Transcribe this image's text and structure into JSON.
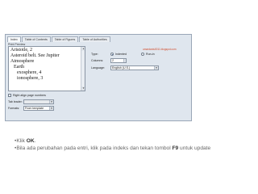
{
  "dialog": {
    "tabs": [
      {
        "label": "Index",
        "active": true
      },
      {
        "label": "Table of Contents",
        "active": false
      },
      {
        "label": "Table of Figures",
        "active": false
      },
      {
        "label": "Table of Authorities",
        "active": false
      }
    ],
    "print_preview_label": "Print Preview",
    "preview_lines": [
      "Aristotle, 2",
      "Asteroid belt. See Jupiter",
      "Atmosphere",
      "Earth",
      "exosphere, 4",
      "ionosphere, 3"
    ],
    "watermark": "umardanis0011.blogspot.com",
    "type_label": "Type:",
    "type_options": [
      {
        "label": "Indented",
        "selected": true
      },
      {
        "label": "Run-in",
        "selected": false
      }
    ],
    "columns_label": "Columns:",
    "columns_value": "2",
    "language_label": "Language:",
    "language_value": "English (U.S.)",
    "right_align_label": "Right align page numbers",
    "tab_leader_label": "Tab leader:",
    "formats_label": "Formats:",
    "formats_value": "From template"
  },
  "bullets": {
    "line1_prefix": "Klik ",
    "line1_bold": "OK",
    "line1_suffix": ".",
    "line2_prefix": "Bila ada perubahan pada entri, klik pada indeks dan tekan tombol ",
    "line2_bold": "F9",
    "line2_suffix": " untuk update"
  },
  "colors": {
    "dialog_bg": "#dfe6ee",
    "bullet_text": "#666666",
    "watermark": "#d24a2a"
  }
}
